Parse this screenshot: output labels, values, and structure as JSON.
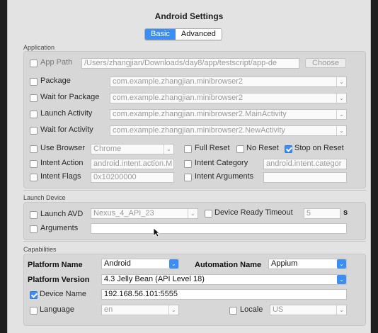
{
  "window": {
    "title": "Android Settings"
  },
  "tabs": {
    "basic": "Basic",
    "advanced": "Advanced"
  },
  "application": {
    "section_label": "Application",
    "app_path": {
      "label": "App Path",
      "value": "/Users/zhangjian/Downloads/day8/app/testscript/app-de",
      "checked": false
    },
    "choose_button": "Choose",
    "package": {
      "label": "Package",
      "value": "com.example.zhangjian.minibrowser2",
      "checked": false
    },
    "wait_for_package": {
      "label": "Wait for Package",
      "value": "com.example.zhangjian.minibrowser2",
      "checked": false
    },
    "launch_activity": {
      "label": "Launch Activity",
      "value": "com.example.zhangjian.minibrowser2.MainActivity",
      "checked": false
    },
    "wait_for_activity": {
      "label": "Wait for Activity",
      "value": "com.example.zhangjian.minibrowser2.NewActivity",
      "checked": false
    },
    "use_browser": {
      "label": "Use Browser",
      "value": "Chrome",
      "checked": false
    },
    "full_reset": {
      "label": "Full Reset",
      "checked": false
    },
    "no_reset": {
      "label": "No Reset",
      "checked": false
    },
    "stop_on_reset": {
      "label": "Stop on Reset",
      "checked": true
    },
    "intent_action": {
      "label": "Intent Action",
      "value": "android.intent.action.M",
      "checked": false
    },
    "intent_category": {
      "label": "Intent Category",
      "value": "android.intent.categor",
      "checked": false
    },
    "intent_flags": {
      "label": "Intent Flags",
      "value": "0x10200000",
      "checked": false
    },
    "intent_arguments": {
      "label": "Intent Arguments",
      "value": "",
      "checked": false
    }
  },
  "launch_device": {
    "section_label": "Launch Device",
    "launch_avd": {
      "label": "Launch AVD",
      "value": "Nexus_4_API_23",
      "checked": false
    },
    "device_ready_timeout": {
      "label": "Device Ready Timeout",
      "value": "5",
      "unit": "s",
      "checked": false
    },
    "arguments": {
      "label": "Arguments",
      "value": "",
      "checked": false
    }
  },
  "capabilities": {
    "section_label": "Capabilities",
    "platform_name": {
      "label": "Platform Name",
      "value": "Android"
    },
    "automation_name": {
      "label": "Automation Name",
      "value": "Appium"
    },
    "platform_version": {
      "label": "Platform Version",
      "value": "4.3 Jelly Bean (API Level 18)"
    },
    "device_name": {
      "label": "Device Name",
      "value": "192.168.56.101:5555",
      "checked": true
    },
    "language": {
      "label": "Language",
      "value": "en",
      "checked": false
    },
    "locale": {
      "label": "Locale",
      "value": "US",
      "checked": false
    }
  },
  "colors": {
    "accent": "#3a8ef6",
    "panel": "#d7d7d7",
    "window": "#e3e3e3"
  }
}
